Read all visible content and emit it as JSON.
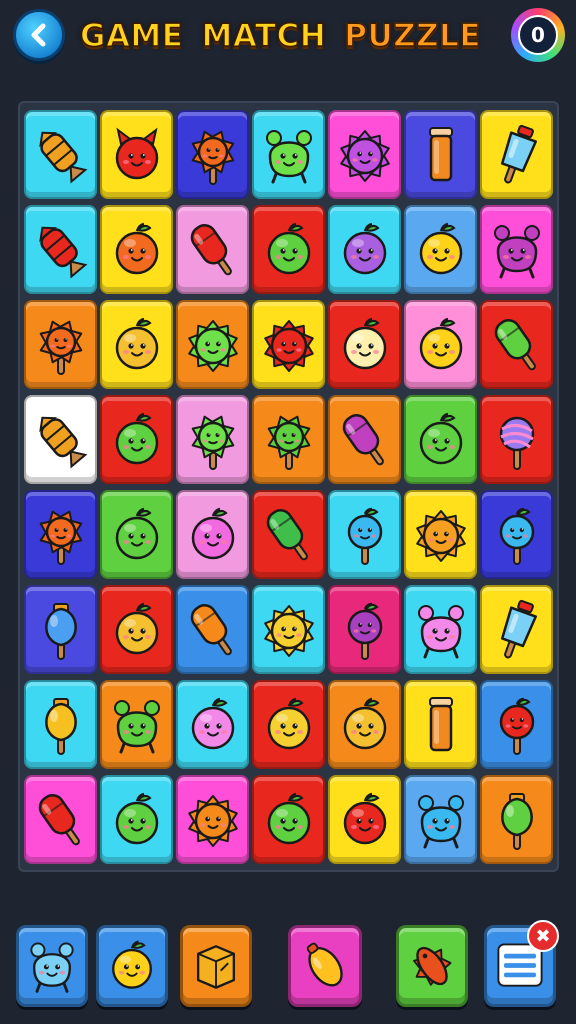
{
  "header": {
    "title_words": [
      "GAME",
      "MATCH",
      "PUZZLE"
    ],
    "counter_value": "0",
    "back_icon": "chevron-left-icon"
  },
  "board": {
    "rows": [
      [
        {
          "color": "#3fd8f2",
          "icon": "candy-wrapper",
          "fill": "#f0a020"
        },
        {
          "color": "#ffe01a",
          "icon": "devil-face",
          "fill": "#e8281e"
        },
        {
          "color": "#3a3ad8",
          "icon": "sun-popsicle",
          "fill": "#f26a1e"
        },
        {
          "color": "#3fd8f2",
          "icon": "blob-creature",
          "fill": "#6ee04a"
        },
        {
          "color": "#ff4fd8",
          "icon": "sun-face",
          "fill": "#c050e0"
        },
        {
          "color": "#4a4ae0",
          "icon": "cylinder",
          "fill": "#f08a20"
        },
        {
          "color": "#ffe01a",
          "icon": "ice-pop",
          "fill": "#7ad0f5"
        }
      ],
      [
        {
          "color": "#3fd8f2",
          "icon": "candy-wrapper",
          "fill": "#e8281e"
        },
        {
          "color": "#ffe01a",
          "icon": "fruit-face",
          "fill": "#f26a1e"
        },
        {
          "color": "#f29ae0",
          "icon": "popsicle",
          "fill": "#e8281e"
        },
        {
          "color": "#e8281e",
          "icon": "fruit-face",
          "fill": "#5fd040"
        },
        {
          "color": "#3fd8f2",
          "icon": "fruit-face",
          "fill": "#a860e0"
        },
        {
          "color": "#5aa8f0",
          "icon": "fruit-face",
          "fill": "#ffd21a"
        },
        {
          "color": "#ff4fd8",
          "icon": "blob-creature",
          "fill": "#c040c0"
        }
      ],
      [
        {
          "color": "#f58a1a",
          "icon": "sun-popsicle",
          "fill": "#f26a1e"
        },
        {
          "color": "#ffe01a",
          "icon": "fruit-face",
          "fill": "#f5c030"
        },
        {
          "color": "#f58a1a",
          "icon": "sun-face",
          "fill": "#6ee04a"
        },
        {
          "color": "#ffe01a",
          "icon": "sun-face",
          "fill": "#e8281e"
        },
        {
          "color": "#e8281e",
          "icon": "fruit-face",
          "fill": "#fff0b0"
        },
        {
          "color": "#ff8fd8",
          "icon": "fruit-face",
          "fill": "#ffd21a"
        },
        {
          "color": "#e8281e",
          "icon": "popsicle",
          "fill": "#5fd040"
        }
      ],
      [
        {
          "color": "#ffffff",
          "icon": "candy-wrapper",
          "fill": "#f0a020"
        },
        {
          "color": "#e8281e",
          "icon": "fruit-face",
          "fill": "#5fd040"
        },
        {
          "color": "#f29ae0",
          "icon": "sun-popsicle",
          "fill": "#6ee04a"
        },
        {
          "color": "#f58a1a",
          "icon": "sun-popsicle",
          "fill": "#5fd040"
        },
        {
          "color": "#f58a1a",
          "icon": "popsicle",
          "fill": "#c040c0"
        },
        {
          "color": "#5fd040",
          "icon": "fruit-face",
          "fill": "#5fd040"
        },
        {
          "color": "#e8281e",
          "icon": "lollipop",
          "fill": "#9a7af0"
        }
      ],
      [
        {
          "color": "#3a3ad8",
          "icon": "sun-popsicle",
          "fill": "#f26a1e"
        },
        {
          "color": "#5fd040",
          "icon": "fruit-face",
          "fill": "#5fd040"
        },
        {
          "color": "#f29ae0",
          "icon": "fruit-face",
          "fill": "#f26ae0"
        },
        {
          "color": "#e8281e",
          "icon": "popsicle",
          "fill": "#3fbf4a"
        },
        {
          "color": "#3fd8f2",
          "icon": "fruit-popsicle",
          "fill": "#3ab8f0"
        },
        {
          "color": "#ffe01a",
          "icon": "sun-face",
          "fill": "#f5a020"
        },
        {
          "color": "#3a3ad8",
          "icon": "fruit-popsicle",
          "fill": "#3ab8f0"
        }
      ],
      [
        {
          "color": "#4a4ae0",
          "icon": "bulb-popsicle",
          "fill": "#4a9ff0"
        },
        {
          "color": "#e8281e",
          "icon": "fruit-face",
          "fill": "#f5c030"
        },
        {
          "color": "#3a90e8",
          "icon": "popsicle",
          "fill": "#f58a1a"
        },
        {
          "color": "#3fd8f2",
          "icon": "sun-face",
          "fill": "#f5d030"
        },
        {
          "color": "#e8287a",
          "icon": "fruit-popsicle",
          "fill": "#a840c0"
        },
        {
          "color": "#3fd8f2",
          "icon": "blob-creature",
          "fill": "#f288e8"
        },
        {
          "color": "#ffe01a",
          "icon": "ice-pop",
          "fill": "#7ad0f5"
        }
      ],
      [
        {
          "color": "#3fd8f2",
          "icon": "bulb-popsicle",
          "fill": "#f5c020"
        },
        {
          "color": "#f58a1a",
          "icon": "blob-creature",
          "fill": "#5fd040"
        },
        {
          "color": "#3fd8f2",
          "icon": "fruit-face",
          "fill": "#f288e8"
        },
        {
          "color": "#e8281e",
          "icon": "fruit-face",
          "fill": "#f5d030"
        },
        {
          "color": "#f58a1a",
          "icon": "fruit-face",
          "fill": "#f5c030"
        },
        {
          "color": "#ffe01a",
          "icon": "cylinder",
          "fill": "#f08a20"
        },
        {
          "color": "#3a90e8",
          "icon": "fruit-popsicle",
          "fill": "#e8281e"
        }
      ],
      [
        {
          "color": "#ff4fd8",
          "icon": "popsicle",
          "fill": "#e8281e"
        },
        {
          "color": "#3fd8f2",
          "icon": "fruit-face",
          "fill": "#5fd040"
        },
        {
          "color": "#ff4fd8",
          "icon": "sun-face",
          "fill": "#f58a1a"
        },
        {
          "color": "#e8281e",
          "icon": "fruit-face",
          "fill": "#5fd040"
        },
        {
          "color": "#ffe01a",
          "icon": "fruit-face",
          "fill": "#e8281e"
        },
        {
          "color": "#5aa8f0",
          "icon": "blob-creature",
          "fill": "#3ab8f0"
        },
        {
          "color": "#f58a1a",
          "icon": "bulb-popsicle",
          "fill": "#5fd040"
        }
      ]
    ]
  },
  "toolbar": {
    "items": [
      {
        "name": "bear-creature-tool",
        "color": "#3a90e8",
        "icon": "blob-creature",
        "fill": "#7ad0f5"
      },
      {
        "name": "fruit-face-tool",
        "color": "#3a90e8",
        "icon": "fruit-face",
        "fill": "#ffd21a"
      },
      {
        "name": "box-tool",
        "color": "#f58a1a",
        "icon": "box",
        "fill": "#f5b020"
      },
      {
        "name": "lemon-tool",
        "color": "#e840c0",
        "icon": "lemon",
        "fill": "#ffc020"
      },
      {
        "name": "spiky-fish-tool",
        "color": "#5fd040",
        "icon": "spiky-fish",
        "fill": "#e8501e"
      },
      {
        "name": "menu-tool",
        "color": "#3a90e8",
        "icon": "menu",
        "fill": "#ffffff",
        "badge": true
      }
    ],
    "badge_icon": "close-x-icon"
  }
}
